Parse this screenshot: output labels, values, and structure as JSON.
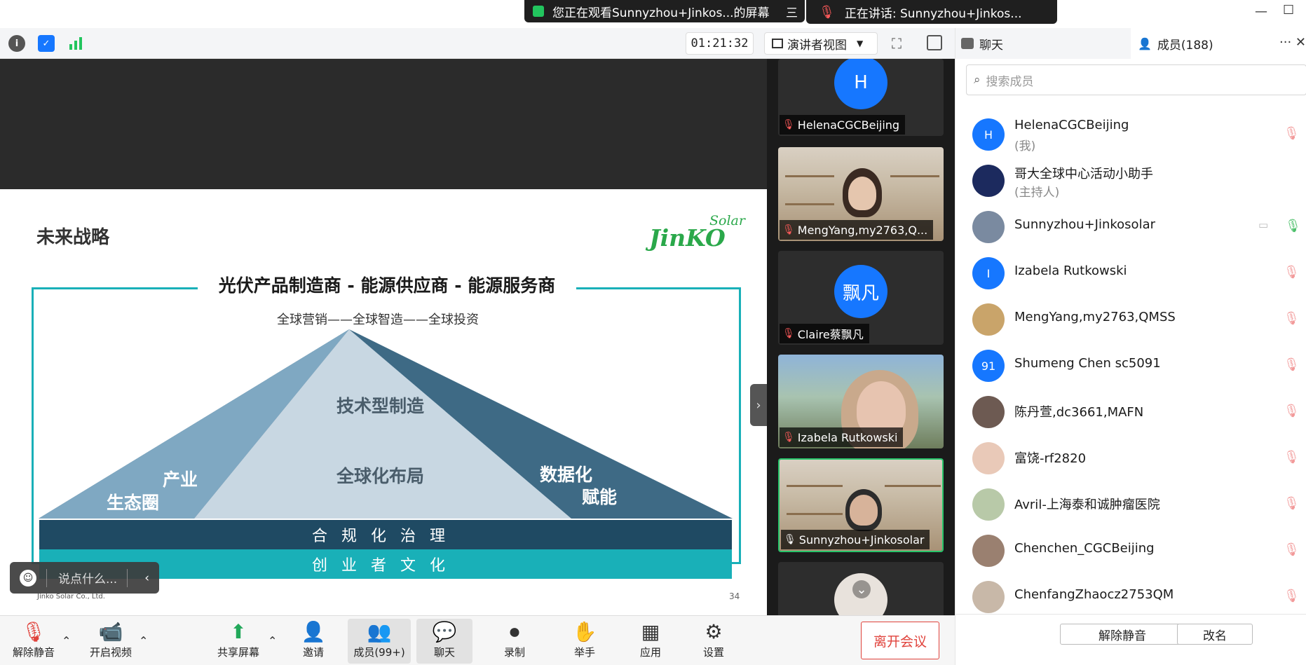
{
  "titlebar": {
    "share_banner": "您正在观看Sunnyzhou+Jinkos...的屏幕",
    "menu_glyph": "三",
    "speaking_banner": "正在讲话: Sunnyzhou+Jinkos..."
  },
  "toolbar": {
    "timer": "01:21:32",
    "view_mode": "演讲者视图"
  },
  "slide": {
    "title": "未来战略",
    "logo_main": "JinKO",
    "logo_sub": "Solar",
    "headline": "光伏产品制造商 - 能源供应商 - 能源服务商",
    "subline": "全球营销——全球智造——全球投资",
    "pyramid_labels": {
      "top": "技术型制造",
      "middle": "全球化布局",
      "left_line1": "产业",
      "left_line2": "生态圈",
      "right_line1": "数据化",
      "right_line2": "赋能"
    },
    "bar_governance": "合规化治理",
    "bar_culture": "创业者文化",
    "footer_company": "Jinko Solar Co., Ltd.",
    "page_number": "34"
  },
  "chat_bubble": {
    "placeholder": "说点什么..."
  },
  "video_tiles": [
    {
      "name": "HelenaCGCBeijing",
      "avatar": "H"
    },
    {
      "name": "MengYang,my2763,Q..."
    },
    {
      "name": "Claire蔡飘凡",
      "avatar": "飘凡"
    },
    {
      "name": "Izabela Rutkowski"
    },
    {
      "name": "Sunnyzhou+Jinkosolar"
    }
  ],
  "panel": {
    "tab_chat": "聊天",
    "tab_members": "成员(188)",
    "search_placeholder": "搜索成员",
    "members": [
      {
        "name": "HelenaCGCBeijing",
        "role": "(我)",
        "avatar": "H",
        "color": "#1677ff"
      },
      {
        "name": "哥大全球中心活动小助手",
        "role": "(主持人)",
        "avatar": "",
        "color": "#1c2a5e"
      },
      {
        "name": "Sunnyzhou+Jinkosolar",
        "role": "",
        "avatar": "",
        "color": "#7a8aa0"
      },
      {
        "name": "Izabela Rutkowski",
        "role": "",
        "avatar": "I",
        "color": "#1677ff"
      },
      {
        "name": "MengYang,my2763,QMSS",
        "role": "",
        "avatar": "",
        "color": "#c9a46a"
      },
      {
        "name": "Shumeng Chen sc5091",
        "role": "",
        "avatar": "91",
        "color": "#1677ff"
      },
      {
        "name": "陈丹萱,dc3661,MAFN",
        "role": "",
        "avatar": "",
        "color": "#6d5a52"
      },
      {
        "name": "富饶-rf2820",
        "role": "",
        "avatar": "",
        "color": "#e9c9b8"
      },
      {
        "name": "Avril-上海泰和诚肿瘤医院",
        "role": "",
        "avatar": "",
        "color": "#b8c9a8"
      },
      {
        "name": "Chenchen_CGCBeijing",
        "role": "",
        "avatar": "",
        "color": "#9a8070"
      },
      {
        "name": "ChenfangZhaocz2753QM",
        "role": "",
        "avatar": "",
        "color": "#c8b8a8"
      }
    ],
    "unmute_all": "解除静音",
    "rename": "改名"
  },
  "controls": {
    "unmute": "解除静音",
    "start_video": "开启视频",
    "share_screen": "共享屏幕",
    "invite": "邀请",
    "members": "成员(99+)",
    "chat": "聊天",
    "record": "录制",
    "raise_hand": "举手",
    "apps": "应用",
    "settings": "设置",
    "leave": "离开会议"
  }
}
